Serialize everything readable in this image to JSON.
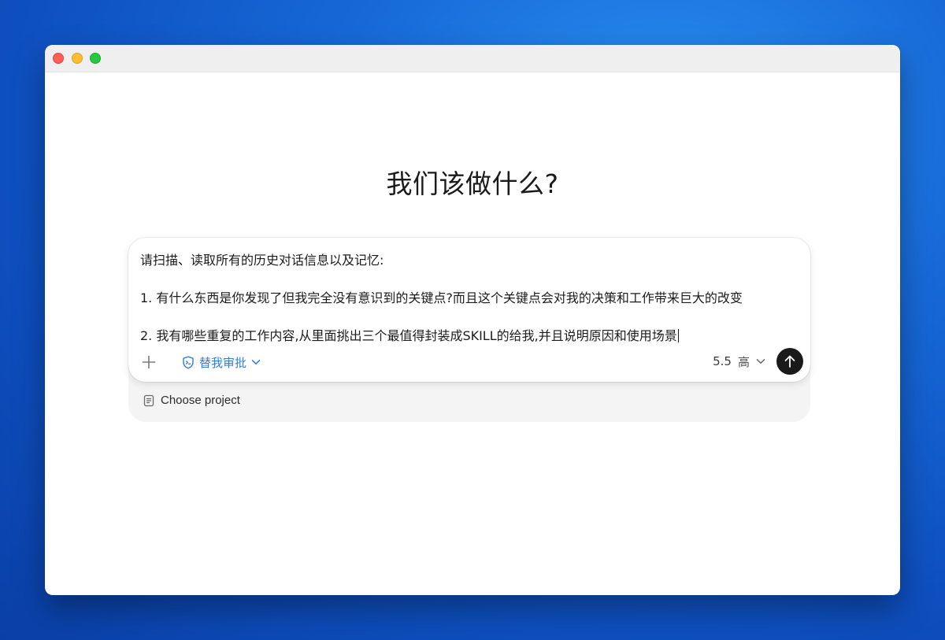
{
  "heading": "我们该做什么?",
  "composer": {
    "prompt_lines": [
      "请扫描、读取所有的历史对话信息以及记忆:",
      "1. 有什么东西是你发现了但我完全没有意识到的关键点?而且这个关键点会对我的决策和工作带来巨大的改变",
      "2. 我有哪些重复的工作内容,从里面挑出三个最值得封装成SKILL的给我,并且说明原因和使用场景"
    ],
    "approval_label": "替我审批",
    "model": "5.5",
    "effort": "高"
  },
  "project": {
    "label": "Choose project"
  },
  "icons": {
    "add": "plus-icon",
    "approval": "shield-icon",
    "dropdown": "chevron-down-icon",
    "send": "arrow-up-icon",
    "project": "document-icon"
  },
  "colors": {
    "accent": "#2f7de1",
    "send_button": "#1a1a1a",
    "close": "#fe5f57",
    "minimize": "#febc2e",
    "maximize": "#28c840"
  }
}
